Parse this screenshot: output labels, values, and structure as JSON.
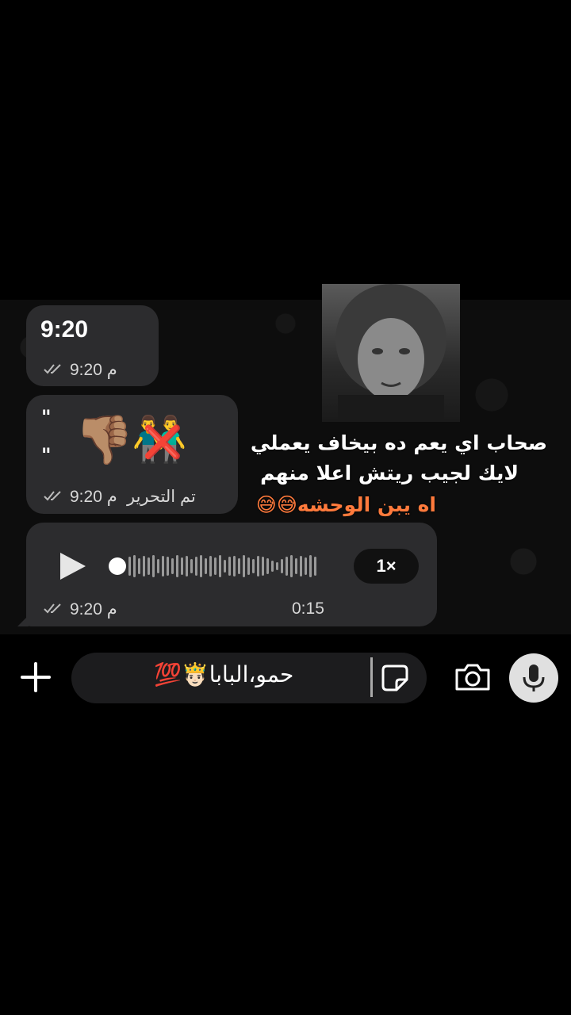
{
  "messages": [
    {
      "type": "text",
      "text": "9:20",
      "time": "9:20 م"
    },
    {
      "type": "emoji",
      "quote_top": "\"",
      "quote_bottom": "\"",
      "emoji_1": "👎🏽",
      "emoji_2": "👬",
      "emoji_3": "❌",
      "edited_label": "تم التحرير",
      "time": "9:20 م"
    },
    {
      "type": "voice",
      "time": "9:20 م",
      "duration": "0:15",
      "speed": "1×"
    }
  ],
  "overlay": {
    "line1": "صحاب اي يعم ده بيخاف يعملي",
    "line2": "لايك لجيب ريتش اعلا منهم",
    "line3": "اه يبن الوحشه😅😅",
    "accent": "#ff7a3c"
  },
  "composer": {
    "text": "حمو،البابا🤴🏻💯"
  },
  "colors": {
    "bubble": "#2c2c2e",
    "background": "#000000",
    "mic_bg": "#e0e0e0"
  },
  "icons": {
    "plus": "plus-icon",
    "sticker": "sticker-icon",
    "camera": "camera-icon",
    "mic": "mic-icon",
    "play": "play-icon",
    "read": "double-check-icon"
  }
}
